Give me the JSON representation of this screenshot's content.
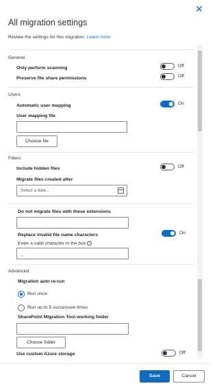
{
  "panel": {
    "title": "All migration settings",
    "subtitle": "Review the settings for this migration.",
    "learn_more": "Learn more"
  },
  "general": {
    "section": "General",
    "only_scanning": {
      "label": "Only perform scanning",
      "state": "Off"
    },
    "preserve_perms": {
      "label": "Preserve file share permissions",
      "state": "Off"
    }
  },
  "users": {
    "section": "Users",
    "auto_mapping": {
      "label": "Automatic user mapping",
      "state": "On"
    },
    "mapping_file_label": "User mapping file",
    "mapping_file_value": "",
    "choose_file": "Choose file"
  },
  "filters": {
    "section": "Filters",
    "include_hidden": {
      "label": "Include hidden files",
      "state": "Off"
    },
    "created_after_label": "Migrate files created after",
    "date_placeholder": "Select a date...",
    "extensions_label": "Do not migrate files with these extensions",
    "extensions_value": "",
    "replace_invalid": {
      "label": "Replace invalid file name characters",
      "state": "On"
    },
    "valid_char_label": "Enter a valid character in the box",
    "valid_char_value": "_"
  },
  "advanced": {
    "section": "Advanced",
    "auto_rerun_label": "Migration auto re-run",
    "run_once": "Run once",
    "run_up_to": "Run up to 5 successive times",
    "working_folder_label": "SharePoint Migration Tool working folder",
    "working_folder_value": "",
    "choose_folder": "Choose folder",
    "custom_azure": {
      "label": "Use custom Azure storage",
      "state": "Off"
    }
  },
  "footer": {
    "save": "Save",
    "cancel": "Cancel"
  },
  "colors": {
    "accent": "#0f6cbd"
  }
}
